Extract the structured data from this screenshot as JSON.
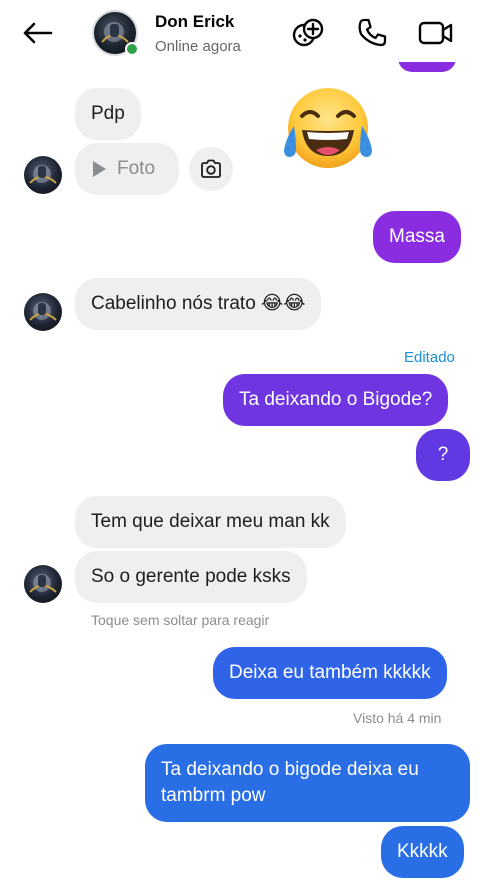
{
  "header": {
    "contact_name": "Don Erick",
    "status": "Online agora"
  },
  "messages": {
    "in_pdp": "Pdp",
    "in_foto": "Foto",
    "out_massa": "Massa",
    "in_cabelinho": "Cabelinho nós trato 😂😂",
    "edited_label": "Editado",
    "out_bigode_q": "Ta deixando o Bigode?",
    "out_question": "?",
    "in_tem_que": "Tem que deixar meu man kk",
    "in_so_gerente": "So o gerente pode ksks",
    "react_hint": "Toque sem soltar para reagir",
    "out_deixa_eu": "Deixa eu também kkkkk",
    "seen_label": "Visto há 4 min",
    "out_bigode_long_1": "Ta deixando o bigode deixa eu",
    "out_bigode_long_2": "tambrm pow",
    "out_kkkkk": "Kkkkk"
  },
  "colors": {
    "accent_purple": "#7b2ff0",
    "accent_blue": "#2a6ee6",
    "online": "#31a24c",
    "edited": "#1a8fd6"
  },
  "icons": [
    "back-arrow-icon",
    "game-controller-icon",
    "phone-icon",
    "video-camera-icon",
    "play-icon",
    "camera-icon",
    "laughing-emoji"
  ]
}
